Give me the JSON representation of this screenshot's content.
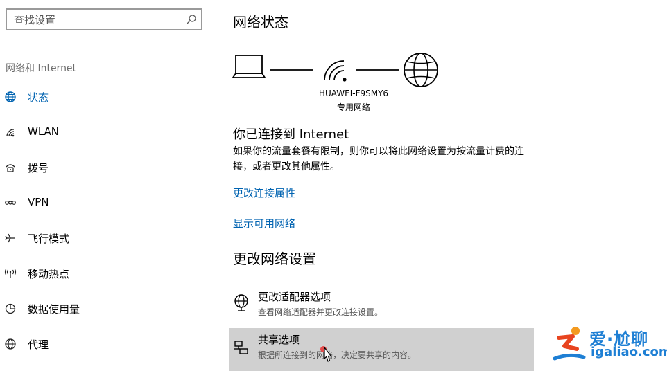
{
  "search": {
    "placeholder": "查找设置"
  },
  "sidebar": {
    "category": "网络和 Internet",
    "items": [
      {
        "label": "状态",
        "icon": "globe-icon",
        "active": true
      },
      {
        "label": "WLAN",
        "icon": "wifi-icon"
      },
      {
        "label": "拨号",
        "icon": "dialup-icon"
      },
      {
        "label": "VPN",
        "icon": "vpn-icon"
      },
      {
        "label": "飞行模式",
        "icon": "airplane-icon"
      },
      {
        "label": "移动热点",
        "icon": "hotspot-icon"
      },
      {
        "label": "数据使用量",
        "icon": "data-usage-icon"
      },
      {
        "label": "代理",
        "icon": "proxy-globe-icon"
      }
    ]
  },
  "main": {
    "title": "网络状态",
    "network": {
      "ssid": "HUAWEI-F9SMY6",
      "type": "专用网络"
    },
    "connected_title": "你已连接到 Internet",
    "connected_desc": "如果你的流量套餐有限制，则你可以将此网络设置为按流量计费的连接，或者更改其他属性。",
    "links": {
      "change_props": "更改连接属性",
      "show_networks": "显示可用网络"
    },
    "change_title": "更改网络设置",
    "options": [
      {
        "title": "更改适配器选项",
        "sub": "查看网络适配器并更改连接设置。",
        "icon": "adapter-globe-icon"
      },
      {
        "title": "共享选项",
        "sub": "根据所连接到的网络，决定要共享的内容。",
        "icon": "sharing-icon"
      }
    ]
  },
  "watermark": {
    "cn": "爱·尬聊",
    "en": "igaliao.com"
  },
  "colors": {
    "accent": "#0063b1",
    "hover_bg": "#d0d0d0",
    "watermark": "#1e7fd4"
  }
}
